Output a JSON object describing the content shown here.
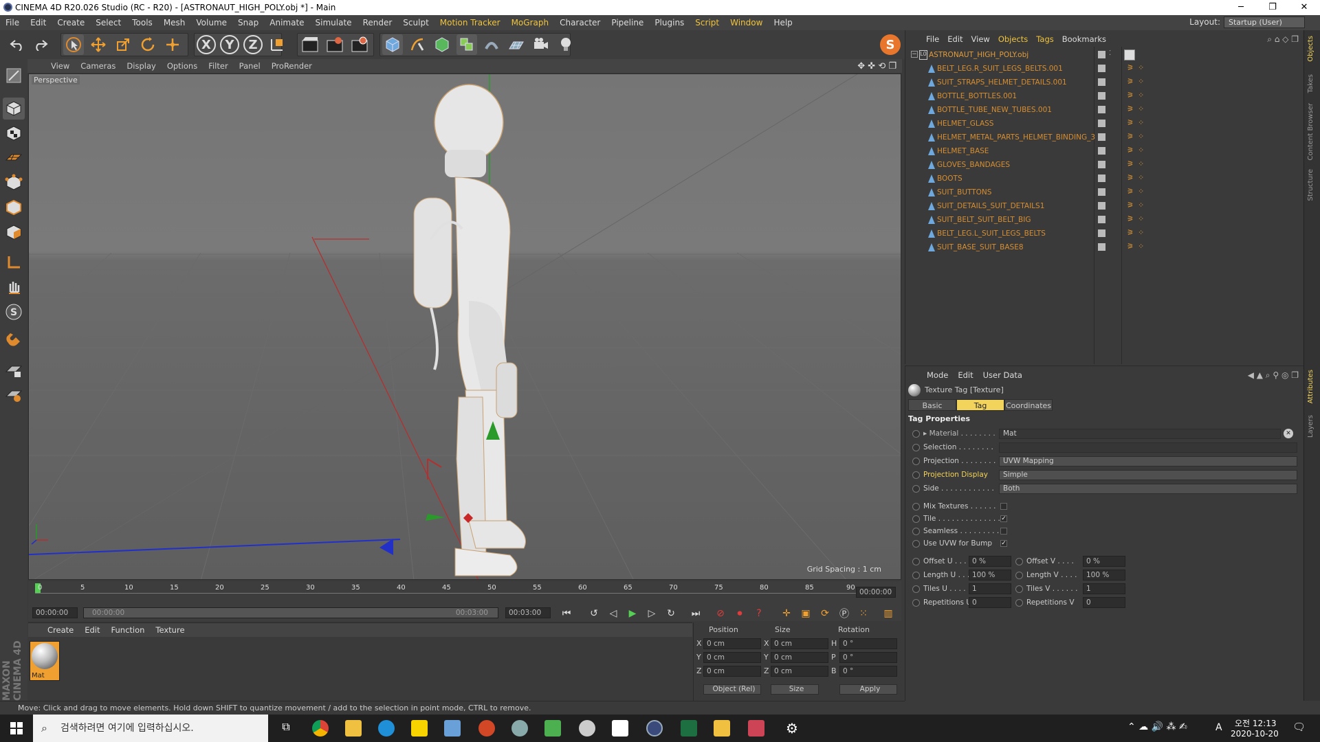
{
  "window": {
    "title": "CINEMA 4D R20.026 Studio (RC - R20) - [ASTRONAUT_HIGH_POLY.obj *] - Main",
    "minimize": "─",
    "maximize": "❐",
    "close": "✕"
  },
  "menubar": {
    "items": [
      "File",
      "Edit",
      "Create",
      "Select",
      "Tools",
      "Mesh",
      "Volume",
      "Snap",
      "Animate",
      "Simulate",
      "Render",
      "Sculpt",
      "Motion Tracker",
      "MoGraph",
      "Character",
      "Pipeline",
      "Plugins",
      "Script",
      "Window",
      "Help"
    ],
    "layout_label": "Layout:",
    "layout_value": "Startup (User)"
  },
  "toolbar": {
    "axis_x": "X",
    "axis_y": "Y",
    "axis_z": "Z"
  },
  "viewport": {
    "menu": [
      "View",
      "Cameras",
      "Display",
      "Options",
      "Filter",
      "Panel",
      "ProRender"
    ],
    "label": "Perspective",
    "grid_spacing": "Grid Spacing : 1 cm"
  },
  "timeline": {
    "ticks": [
      "0",
      "5",
      "10",
      "15",
      "20",
      "25",
      "30",
      "35",
      "40",
      "45",
      "50",
      "55",
      "60",
      "65",
      "70",
      "75",
      "80",
      "85",
      "90"
    ],
    "current_frame_right": "00:00:00",
    "start": "00:00:00",
    "range_start": "00:00:00",
    "range_end": "00:03:00",
    "end": "00:03:00"
  },
  "material_manager": {
    "menu": [
      "Create",
      "Edit",
      "Function",
      "Texture"
    ],
    "material_name": "Mat"
  },
  "coordinates": {
    "headers": [
      "Position",
      "Size",
      "Rotation"
    ],
    "rows": [
      {
        "axis": "X",
        "pos": "0 cm",
        "saxis": "X",
        "size": "0 cm",
        "raxis": "H",
        "rot": "0 °"
      },
      {
        "axis": "Y",
        "pos": "0 cm",
        "saxis": "Y",
        "size": "0 cm",
        "raxis": "P",
        "rot": "0 °"
      },
      {
        "axis": "Z",
        "pos": "0 cm",
        "saxis": "Z",
        "size": "0 cm",
        "raxis": "B",
        "rot": "0 °"
      }
    ],
    "mode": "Object (Rel)",
    "size_mode": "Size",
    "apply": "Apply"
  },
  "object_manager": {
    "menu": [
      "File",
      "Edit",
      "View",
      "Objects",
      "Tags",
      "Bookmarks"
    ],
    "root": "ASTRONAUT_HIGH_POLY.obj",
    "children": [
      "BELT_LEG.R_SUIT_LEGS_BELTS.001",
      "SUIT_STRAPS_HELMET_DETAILS.001",
      "BOTTLE_BOTTLES.001",
      "BOTTLE_TUBE_NEW_TUBES.001",
      "HELMET_GLASS",
      "HELMET_METAL_PARTS_HELMET_BINDING_3",
      "HELMET_BASE",
      "GLOVES_BANDAGES",
      "BOOTS",
      "SUIT_BUTTONS",
      "SUIT_DETAILS_SUIT_DETAILS1",
      "SUIT_BELT_SUIT_BELT_BIG",
      "BELT_LEG.L_SUIT_LEGS_BELTS",
      "SUIT_BASE_SUIT_BASE8"
    ]
  },
  "attribute_manager": {
    "menu": [
      "Mode",
      "Edit",
      "User Data"
    ],
    "title": "Texture Tag [Texture]",
    "tabs": [
      "Basic",
      "Tag",
      "Coordinates"
    ],
    "section": "Tag Properties",
    "material_label": "Material",
    "material_value": "Mat",
    "selection_label": "Selection",
    "projection_label": "Projection",
    "projection_value": "UVW Mapping",
    "projection_display_label": "Projection Display",
    "projection_display_value": "Simple",
    "side_label": "Side",
    "side_value": "Both",
    "mix_textures_label": "Mix Textures",
    "tile_label": "Tile",
    "seamless_label": "Seamless",
    "use_uvw_label": "Use UVW for Bump",
    "check": "✓",
    "offset_u_label": "Offset U",
    "offset_u": "0 %",
    "offset_v_label": "Offset V",
    "offset_v": "0 %",
    "length_u_label": "Length U",
    "length_u": "100 %",
    "length_v_label": "Length V",
    "length_v": "100 %",
    "tiles_u_label": "Tiles U",
    "tiles_u": "1",
    "tiles_v_label": "Tiles V",
    "tiles_v": "1",
    "rep_u_label": "Repetitions U",
    "rep_u": "0",
    "rep_v_label": "Repetitions V",
    "rep_v": "0"
  },
  "right_tabs": [
    "Objects",
    "Takes",
    "Content Browser",
    "Structure",
    "Attributes",
    "Layers"
  ],
  "statusbar": "Move: Click and drag to move elements. Hold down SHIFT to quantize movement / add to the selection in point mode, CTRL to remove.",
  "maxon": "MAXON CINEMA 4D",
  "taskbar": {
    "search_placeholder": "검색하려면 여기에 입력하십시오.",
    "time": "오전 12:13",
    "date": "2020-10-20",
    "ime": "A"
  }
}
